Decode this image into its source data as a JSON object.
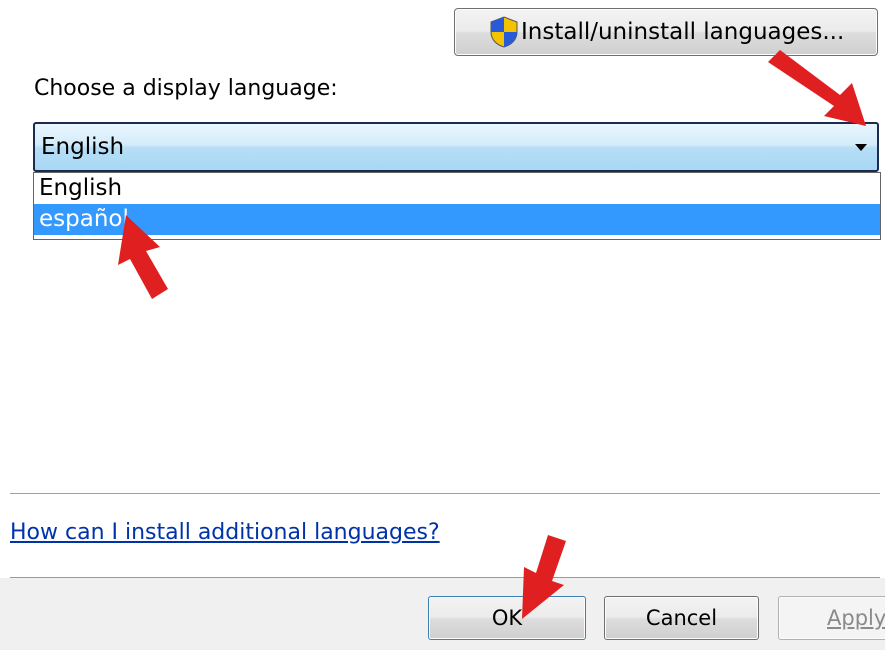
{
  "install_button": {
    "label": "Install/uninstall languages..."
  },
  "language": {
    "prompt": "Choose a display language:",
    "selected_value": "English",
    "options": [
      "English",
      "español"
    ],
    "highlighted_index": 1
  },
  "help_link": "How can I install additional languages?",
  "buttons": {
    "ok": "OK",
    "cancel": "Cancel",
    "apply": "Apply"
  },
  "colors": {
    "highlight": "#3399ff",
    "annotation_arrow": "#e02020",
    "link": "#0033aa"
  }
}
